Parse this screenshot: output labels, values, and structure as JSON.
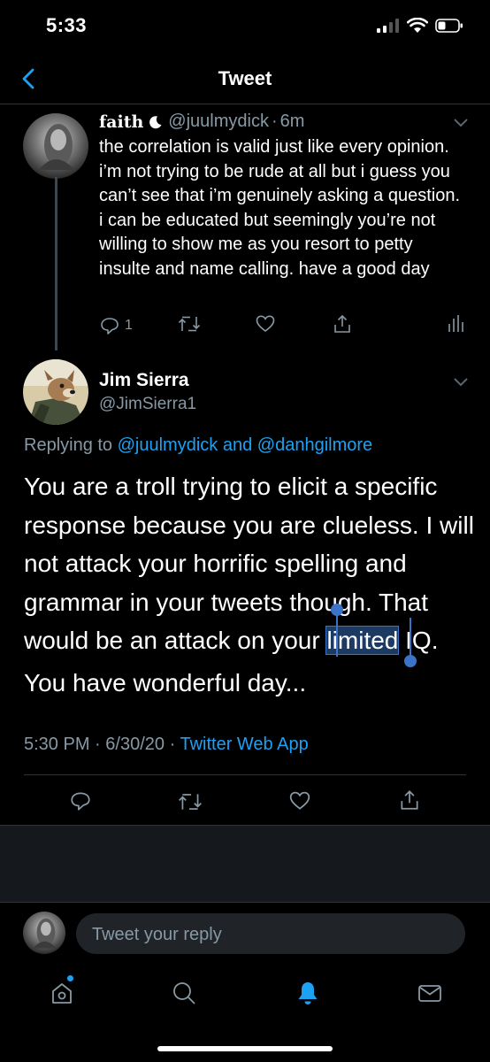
{
  "status": {
    "time": "5:33"
  },
  "nav": {
    "title": "Tweet"
  },
  "parent_tweet": {
    "name": "faith",
    "handle": "@juulmydick",
    "separator": "·",
    "age": "6m",
    "text": "the correlation is valid just like every opinion. i’m not trying to be rude at all but i guess you can’t see that i’m genuinely asking a question. i can be educated but seemingly you’re not willing to show me as you resort to petty insulte and name calling. have a good day",
    "reply_count": "1"
  },
  "main_tweet": {
    "name": "Jim Sierra",
    "handle": "@JimSierra1",
    "replying_prefix": "Replying to",
    "replying_user1": "@juulmydick",
    "replying_and": "and",
    "replying_user2": "@danhgilmore",
    "body_before_selection": "You are a troll trying to elicit a specific response because  you are clueless. I will not attack your horrific spelling and grammar in your tweets though. That would be an attack on your ",
    "body_selected": "limited",
    "body_after_selection": " IQ.",
    "body_second": "You have wonderful day...",
    "time": "5:30 PM",
    "date": "6/30/20",
    "meta_sep": "·",
    "source": "Twitter Web App"
  },
  "composer": {
    "placeholder": "Tweet your reply"
  },
  "colors": {
    "accent": "#1da1f2",
    "muted": "#8899a6",
    "background": "#000000",
    "selection": "#3a73c7"
  },
  "icons": {
    "status": [
      "cellular-signal-icon",
      "wifi-icon",
      "battery-icon"
    ],
    "actions": [
      "reply-icon",
      "retweet-icon",
      "like-icon",
      "share-icon",
      "analytics-icon"
    ],
    "tabs": [
      "home-icon",
      "search-icon",
      "notifications-icon",
      "messages-icon"
    ]
  }
}
